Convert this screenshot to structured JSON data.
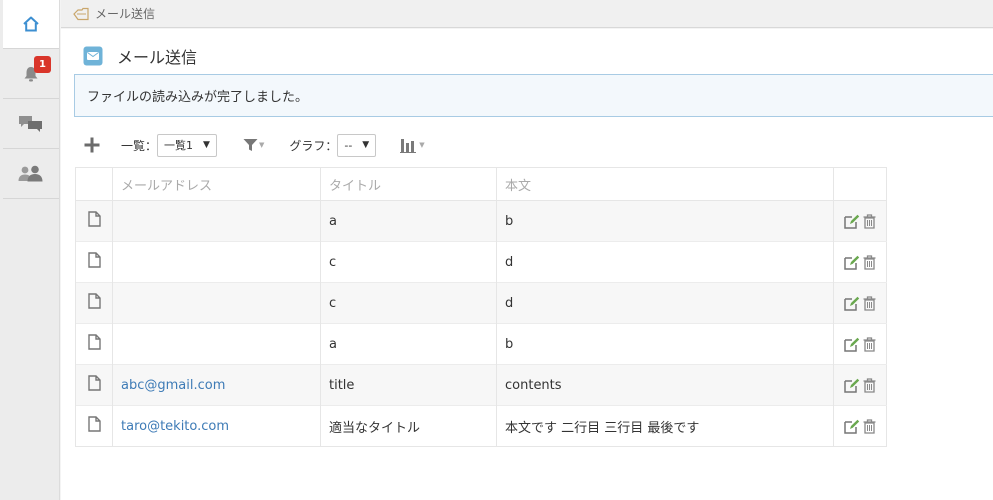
{
  "breadcrumb": {
    "label": "メール送信"
  },
  "sidebar": {
    "notification_count": "1"
  },
  "page": {
    "title": "メール送信"
  },
  "notice": {
    "message": "ファイルの読み込みが完了しました。"
  },
  "toolbar": {
    "view_label": "一覧：",
    "view_value": "一覧1",
    "graph_label": "グラフ：",
    "graph_value": "--"
  },
  "table": {
    "headers": {
      "email": "メールアドレス",
      "title": "タイトル",
      "body": "本文"
    },
    "rows": [
      {
        "email": "",
        "title": "a",
        "body": "b"
      },
      {
        "email": "",
        "title": "c",
        "body": "d"
      },
      {
        "email": "",
        "title": "c",
        "body": "d"
      },
      {
        "email": "",
        "title": "a",
        "body": "b"
      },
      {
        "email": "abc@gmail.com",
        "title": "title",
        "body": "contents"
      },
      {
        "email": "taro@tekito.com",
        "title": "適当なタイトル",
        "body": "本文です 二行目 三行目 最後です"
      }
    ]
  },
  "colors": {
    "accent": "#3e7bb6",
    "badge": "#d9352a",
    "edit_icon": "#6aa84f",
    "notice_border": "#a8cbe4"
  }
}
